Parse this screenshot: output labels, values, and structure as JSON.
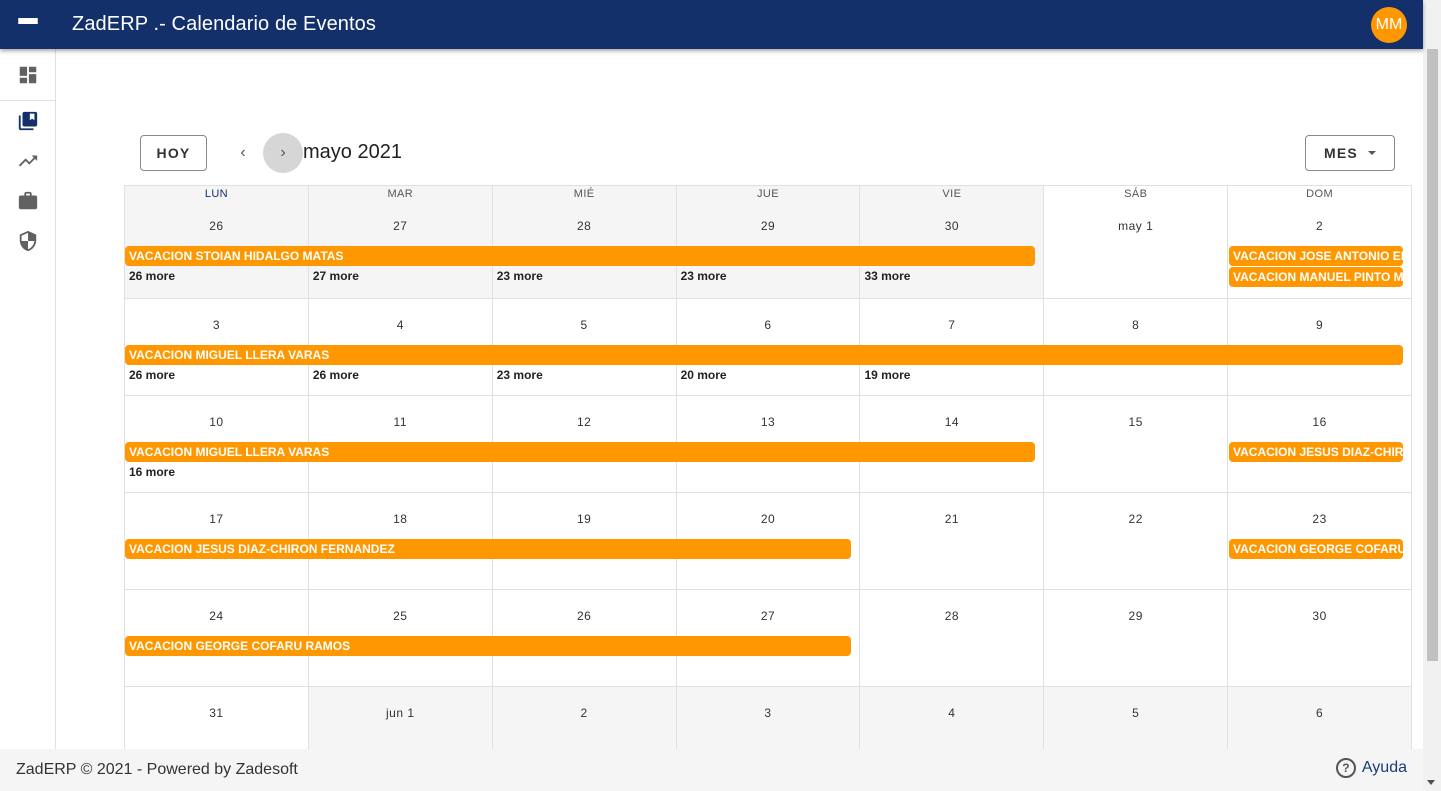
{
  "app": {
    "title": "ZadERP .- Calendario de Eventos",
    "avatar_initials": "MM"
  },
  "sidebar": {
    "items": [
      "dashboard-icon",
      "library-books-icon",
      "trending-up-icon",
      "work-icon",
      "security-icon"
    ]
  },
  "toolbar": {
    "today_label": "HOY",
    "title": "mayo 2021",
    "view_label": "MES"
  },
  "calendar": {
    "weekdays": [
      "LUN",
      "MAR",
      "MIÉ",
      "JUE",
      "VIE",
      "SÁB",
      "DOM"
    ],
    "weeks": [
      {
        "days": [
          "26",
          "27",
          "28",
          "29",
          "30",
          "may 1",
          "2"
        ],
        "more": [
          "26 more",
          "27 more",
          "23 more",
          "23 more",
          "33 more",
          "",
          ""
        ],
        "events": [
          {
            "label": "VACACION STOIAN HIDALGO MATAS"
          },
          {
            "label": "VACACION JOSE ANTONIO EDDIE"
          },
          {
            "label": "VACACION MANUEL PINTO MONTES"
          }
        ]
      },
      {
        "days": [
          "3",
          "4",
          "5",
          "6",
          "7",
          "8",
          "9"
        ],
        "more": [
          "26 more",
          "26 more",
          "23 more",
          "20 more",
          "19 more",
          "",
          ""
        ],
        "events": [
          {
            "label": "VACACION MIGUEL LLERA VARAS"
          }
        ]
      },
      {
        "days": [
          "10",
          "11",
          "12",
          "13",
          "14",
          "15",
          "16"
        ],
        "more": [
          "16 more",
          "",
          "",
          "",
          "",
          "",
          ""
        ],
        "events": [
          {
            "label": "VACACION MIGUEL LLERA VARAS"
          },
          {
            "label": "VACACION JESUS DIAZ-CHIRON FERNANDEZ"
          }
        ]
      },
      {
        "days": [
          "17",
          "18",
          "19",
          "20",
          "21",
          "22",
          "23"
        ],
        "more": [
          "",
          "",
          "",
          "",
          "",
          "",
          ""
        ],
        "events": [
          {
            "label": "VACACION JESUS DIAZ-CHIRON FERNANDEZ"
          },
          {
            "label": "VACACION GEORGE COFARU RAMOS"
          }
        ]
      },
      {
        "days": [
          "24",
          "25",
          "26",
          "27",
          "28",
          "29",
          "30"
        ],
        "more": [
          "",
          "",
          "",
          "",
          "",
          "",
          ""
        ],
        "events": [
          {
            "label": "VACACION GEORGE COFARU RAMOS"
          }
        ]
      },
      {
        "days": [
          "31",
          "jun 1",
          "2",
          "3",
          "4",
          "5",
          "6"
        ],
        "more": [
          "",
          "",
          "",
          "",
          "",
          "",
          ""
        ],
        "events": []
      }
    ]
  },
  "footer": {
    "text": "ZadERP © 2021 - Powered by Zadesoft",
    "help_label": "Ayuda",
    "help_icon_glyph": "?"
  },
  "colors": {
    "appbar": "#13306a",
    "event": "#ff9800",
    "avatar": "#ff9800"
  }
}
